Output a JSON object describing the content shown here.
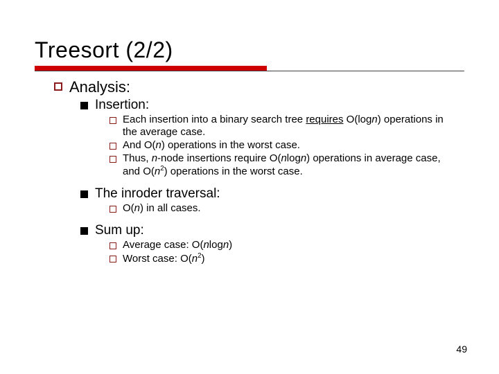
{
  "title": "Treesort (2/2)",
  "analysis_label": "Analysis:",
  "insertion": {
    "label": "Insertion:",
    "p1_a": "Each insertion into a binary search tree ",
    "p1_req": "requires",
    "p1_b": " O(log",
    "p1_n": "n",
    "p1_c": ") operations in the average case.",
    "p2_a": "And O(",
    "p2_n": "n",
    "p2_b": ") operations in the worst case.",
    "p3_a": "Thus, ",
    "p3_n1": "n",
    "p3_b": "-node insertions require O(",
    "p3_n2": "n",
    "p3_c": "log",
    "p3_n3": "n",
    "p3_d": ") operations in average case, and O(",
    "p3_n4": "n",
    "p3_sup": "2",
    "p3_e": ") operations in the worst case."
  },
  "traversal": {
    "label": "The inroder traversal:",
    "p1_a": "O(",
    "p1_n": "n",
    "p1_b": ") in all cases."
  },
  "sum": {
    "label": "Sum up:",
    "avg_a": "Average case: O(",
    "avg_n1": "n",
    "avg_b": "log",
    "avg_n2": "n",
    "avg_c": ")",
    "worst_a": "Worst case: O(",
    "worst_n": "n",
    "worst_sup": "2",
    "worst_b": ")"
  },
  "page_number": "49"
}
